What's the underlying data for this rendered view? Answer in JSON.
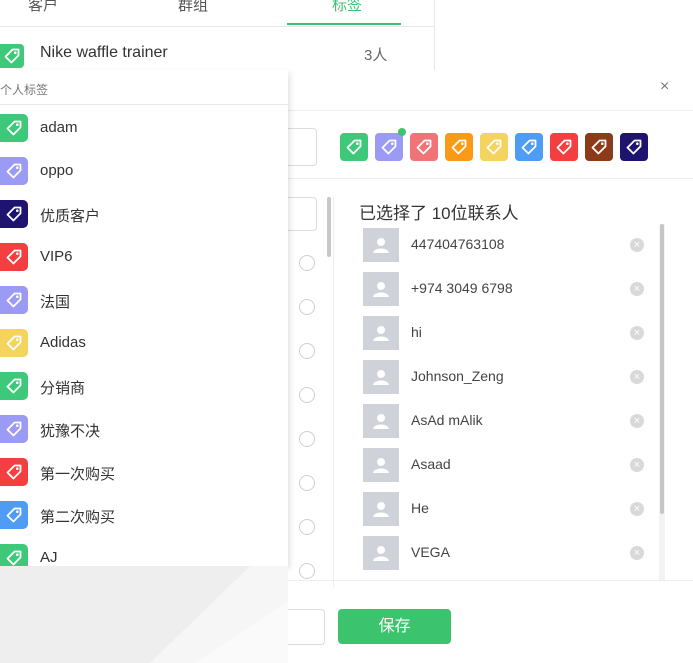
{
  "colors": {
    "accent": "#3cc36d",
    "tag_green": "#3ec97a",
    "tag_lavender": "#9b9af4",
    "tag_pink": "#f07377",
    "tag_orange": "#fb9a17",
    "tag_yellow": "#f4d35e",
    "tag_blue": "#4f9cf5",
    "tag_red": "#f33f3f",
    "tag_brown": "#8c3b1a",
    "tag_navy": "#1e1470"
  },
  "back_panel": {
    "tabs": [
      {
        "label": "客户",
        "active": false
      },
      {
        "label": "群组",
        "active": false
      },
      {
        "label": "标签",
        "active": true
      }
    ],
    "nike_tag": {
      "label": "Nike waffle trainer",
      "count": "3人",
      "icon": "tag-icon",
      "color": "#3ec97a"
    }
  },
  "popover": {
    "header": "个人标签",
    "tags": [
      {
        "label": "adam",
        "color": "#3ec97a",
        "icon": "tag-icon"
      },
      {
        "label": "oppo",
        "color": "#9b9af4",
        "icon": "tag-icon"
      },
      {
        "label": "优质客户",
        "color": "#1e1470",
        "icon": "tag-icon"
      },
      {
        "label": "VIP6",
        "color": "#f33f3f",
        "icon": "tag-icon"
      },
      {
        "label": "法国",
        "color": "#9b9af4",
        "icon": "tag-icon"
      },
      {
        "label": "Adidas",
        "color": "#f4d35e",
        "icon": "tag-icon"
      },
      {
        "label": "分销商",
        "color": "#3ec97a",
        "icon": "tag-icon"
      },
      {
        "label": "犹豫不决",
        "color": "#9b9af4",
        "icon": "tag-icon"
      },
      {
        "label": "第一次购买",
        "color": "#f33f3f",
        "icon": "tag-icon"
      },
      {
        "label": "第二次购买",
        "color": "#4f9cf5",
        "icon": "tag-icon"
      },
      {
        "label": "AJ",
        "color": "#3ec97a",
        "icon": "tag-icon"
      }
    ]
  },
  "dialog": {
    "close_icon": "close-icon",
    "close_glyph": "×",
    "palette": [
      {
        "color": "#3ec97a",
        "selected": false
      },
      {
        "color": "#9b9af4",
        "selected": true
      },
      {
        "color": "#f07377",
        "selected": false
      },
      {
        "color": "#fb9a17",
        "selected": false
      },
      {
        "color": "#f4d35e",
        "selected": false
      },
      {
        "color": "#4f9cf5",
        "selected": false
      },
      {
        "color": "#f33f3f",
        "selected": false
      },
      {
        "color": "#8c3b1a",
        "selected": false
      },
      {
        "color": "#1e1470",
        "selected": false
      }
    ],
    "selected_title": "已选择了 10位联系人",
    "contacts": [
      {
        "name": "447404763108"
      },
      {
        "name": "+974 3049 6798"
      },
      {
        "name": "hi"
      },
      {
        "name": "Johnson_Zeng"
      },
      {
        "name": "AsAd mAlik"
      },
      {
        "name": "Asaad"
      },
      {
        "name": "He"
      },
      {
        "name": "VEGA"
      }
    ],
    "remove_glyph": "×",
    "save_label": "保存"
  }
}
